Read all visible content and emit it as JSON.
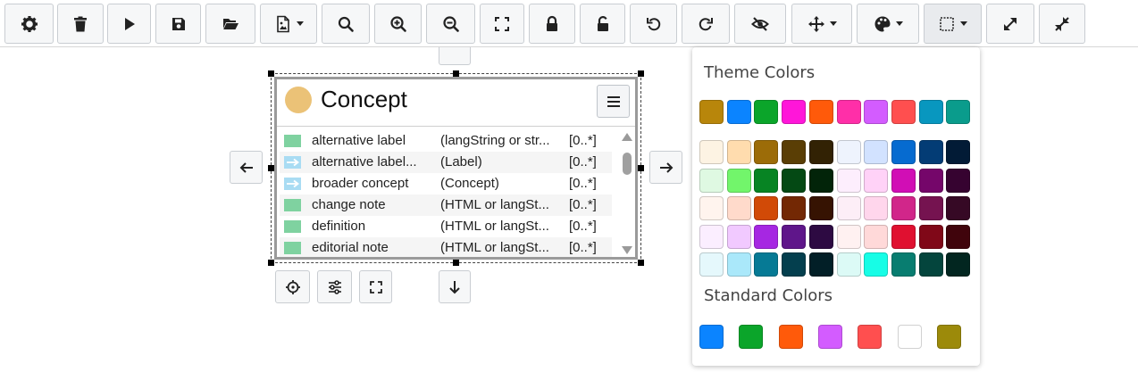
{
  "toolbar": {
    "buttons": [
      {
        "name": "settings-button",
        "icon": "gear-icon"
      },
      {
        "name": "delete-button",
        "icon": "trash-icon"
      },
      {
        "name": "play-button",
        "icon": "play-icon"
      },
      {
        "name": "save-button",
        "icon": "floppy-icon"
      },
      {
        "name": "open-button",
        "icon": "folder-open-icon"
      },
      {
        "name": "export-image-button",
        "icon": "image-file-icon"
      },
      {
        "name": "search-button",
        "icon": "search-icon"
      },
      {
        "name": "zoom-in-button",
        "icon": "zoom-in-icon"
      },
      {
        "name": "zoom-out-button",
        "icon": "zoom-out-icon"
      },
      {
        "name": "fit-view-button",
        "icon": "fullscreen-icon"
      },
      {
        "name": "lock-button",
        "icon": "lock-icon"
      },
      {
        "name": "unlock-button",
        "icon": "unlock-icon"
      },
      {
        "name": "undo-button",
        "icon": "undo-icon"
      },
      {
        "name": "redo-button",
        "icon": "redo-icon"
      },
      {
        "name": "hide-button",
        "icon": "eye-slash-icon"
      },
      {
        "name": "move-button",
        "icon": "arrows-move-icon"
      },
      {
        "name": "color-palette-button",
        "icon": "palette-icon"
      },
      {
        "name": "border-style-button",
        "icon": "dashed-square-icon"
      },
      {
        "name": "expand-button",
        "icon": "expand-icon"
      },
      {
        "name": "collapse-button",
        "icon": "collapse-icon"
      }
    ]
  },
  "node": {
    "title": "Concept",
    "color": "#ebc277",
    "rows": [
      {
        "kind": "attribute",
        "label": "alternative label",
        "range": "(langString or str...",
        "card": "[0..*]"
      },
      {
        "kind": "relation",
        "label": "alternative label...",
        "range": "(Label)",
        "card": "[0..*]"
      },
      {
        "kind": "relation",
        "label": "broader concept",
        "range": "(Concept)",
        "card": "[0..*]"
      },
      {
        "kind": "attribute",
        "label": "change note",
        "range": "(HTML or langSt...",
        "card": "[0..*]"
      },
      {
        "kind": "attribute",
        "label": "definition",
        "range": "(HTML or langSt...",
        "card": "[0..*]"
      },
      {
        "kind": "attribute",
        "label": "editorial note",
        "range": "(HTML or langSt...",
        "card": "[0..*]"
      }
    ]
  },
  "colors_panel": {
    "theme_title": "Theme Colors",
    "standard_title": "Standard Colors",
    "theme_row": [
      "#b8860b",
      "#0b84ff",
      "#0ba52a",
      "#ff16d9",
      "#ff5a0a",
      "#ff2fa8",
      "#d35cff",
      "#ff4f4f",
      "#0897bf",
      "#0a9c8c"
    ],
    "theme_grid": [
      [
        "#fdf3e3",
        "#ffdcae",
        "#9c6c08",
        "#5a3e05",
        "#322204",
        "#eef3fd",
        "#d2e2ff",
        "#066bd0",
        "#033c75",
        "#021b36"
      ],
      [
        "#dff9e2",
        "#72f56b",
        "#078423",
        "#044914",
        "#022409",
        "#fdeefd",
        "#ffd2f7",
        "#d10eb5",
        "#75066a",
        "#360330"
      ],
      [
        "#fff4ee",
        "#ffdacb",
        "#d14a07",
        "#732804",
        "#361302",
        "#fdeef7",
        "#ffd6ec",
        "#d1268a",
        "#751350",
        "#360925"
      ],
      [
        "#fbeeff",
        "#f1c9ff",
        "#a627e2",
        "#5f168a",
        "#2d0a42",
        "#fff1f1",
        "#ffd9d9",
        "#e01030",
        "#800818",
        "#40040c"
      ],
      [
        "#e5f8fc",
        "#aae8fa",
        "#067a95",
        "#043f4e",
        "#021f27",
        "#dcfaf6",
        "#17fde6",
        "#087d70",
        "#04453d",
        "#022620"
      ]
    ],
    "standard": [
      "#0b84ff",
      "#0ba52a",
      "#ff5a0a",
      "#d35cff",
      "#ff4f4f",
      "#ffffff",
      "#9c8a0a"
    ]
  }
}
